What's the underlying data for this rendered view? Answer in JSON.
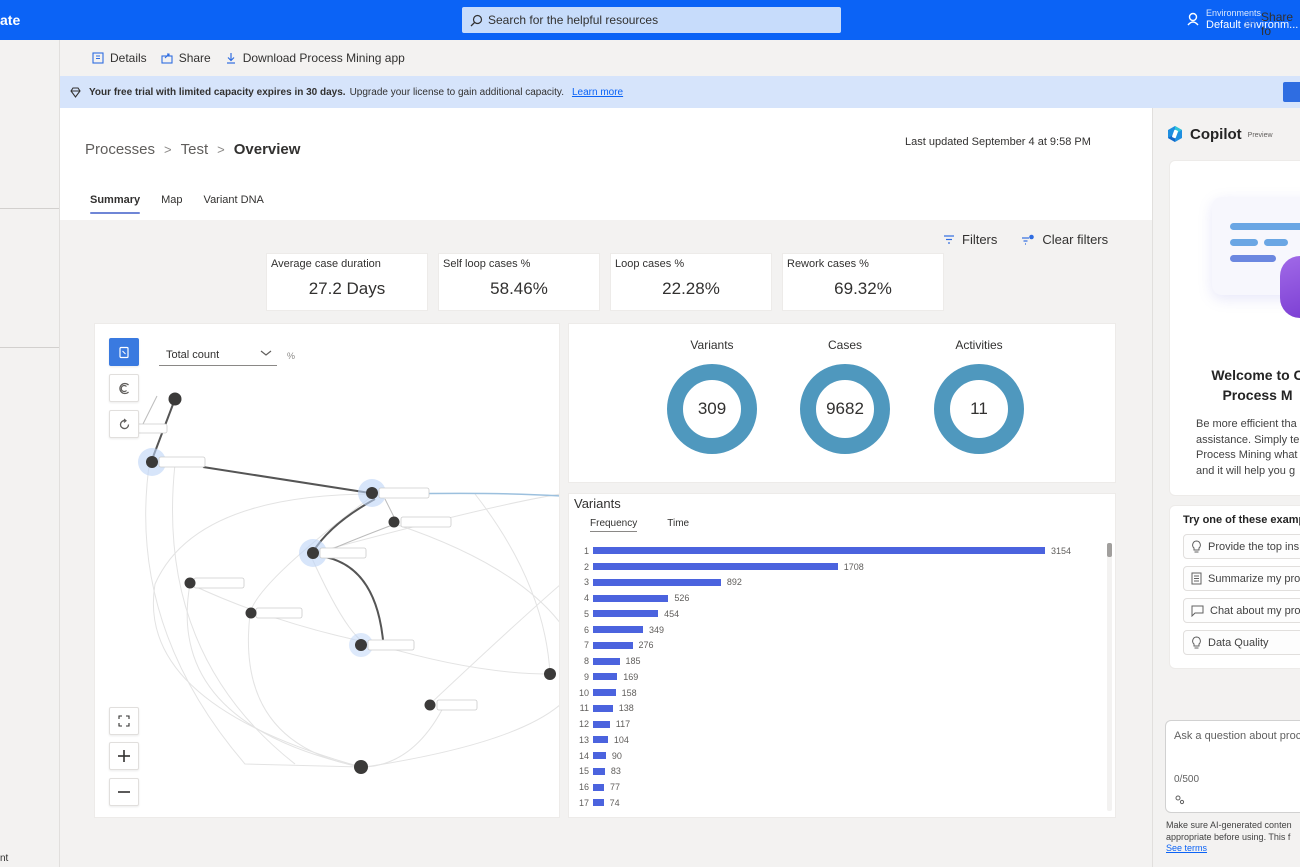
{
  "topbar": {
    "app_title": "ate",
    "search_placeholder": "Search for the helpful resources",
    "environment_label": "Environments",
    "environment_value": "Default environm..."
  },
  "leftnav": {
    "bottom_text": "nt"
  },
  "commandbar": {
    "details": "Details",
    "share": "Share",
    "download": "Download Process Mining app",
    "share_right": "Share fo"
  },
  "banner": {
    "bold": "Your free trial with limited capacity expires in 30 days.",
    "text": "Upgrade your license to gain additional capacity.",
    "link": "Learn more"
  },
  "breadcrumb": {
    "items": [
      "Processes",
      "Test"
    ],
    "current": "Overview",
    "separator": ">"
  },
  "last_updated": "Last updated September 4 at 9:58 PM",
  "tabs": [
    {
      "label": "Summary",
      "active": true
    },
    {
      "label": "Map",
      "active": false
    },
    {
      "label": "Variant DNA",
      "active": false
    }
  ],
  "filters": {
    "filters_label": "Filters",
    "clear_label": "Clear filters"
  },
  "kpis": [
    {
      "label": "Average case duration",
      "value": "27.2 Days"
    },
    {
      "label": "Self loop cases %",
      "value": "58.46%"
    },
    {
      "label": "Loop cases %",
      "value": "22.28%"
    },
    {
      "label": "Rework cases %",
      "value": "69.32%"
    }
  ],
  "process_map": {
    "measure_select": "Total count",
    "percent_toggle": "%"
  },
  "stats": [
    {
      "label": "Variants",
      "value": "309"
    },
    {
      "label": "Cases",
      "value": "9682"
    },
    {
      "label": "Activities",
      "value": "11"
    }
  ],
  "variants": {
    "title": "Variants",
    "tabs": [
      "Frequency",
      "Time"
    ],
    "active_tab": "Frequency",
    "max": 3154,
    "items": [
      {
        "rank": "1",
        "value": 3154
      },
      {
        "rank": "2",
        "value": 1708
      },
      {
        "rank": "3",
        "value": 892
      },
      {
        "rank": "4",
        "value": 526
      },
      {
        "rank": "5",
        "value": 454
      },
      {
        "rank": "6",
        "value": 349
      },
      {
        "rank": "7",
        "value": 276
      },
      {
        "rank": "8",
        "value": 185
      },
      {
        "rank": "9",
        "value": 169
      },
      {
        "rank": "10",
        "value": 158
      },
      {
        "rank": "11",
        "value": 138
      },
      {
        "rank": "12",
        "value": 117
      },
      {
        "rank": "13",
        "value": 104
      },
      {
        "rank": "14",
        "value": 90
      },
      {
        "rank": "15",
        "value": 83
      },
      {
        "rank": "16",
        "value": 77
      },
      {
        "rank": "17",
        "value": 74
      }
    ]
  },
  "copilot": {
    "title": "Copilot",
    "badge": "Preview",
    "welcome_line1": "Welcome to C",
    "welcome_line2": "Process M",
    "description": [
      "Be more efficient tha",
      "assistance. Simply tel",
      "Process Mining what",
      "and it will help you g"
    ],
    "examples_title": "Try one of these examp",
    "examples": [
      {
        "icon": "lightbulb-icon",
        "label": "Provide the top ins"
      },
      {
        "icon": "document-icon",
        "label": "Summarize my pro"
      },
      {
        "icon": "chat-icon",
        "label": "Chat about my pro"
      },
      {
        "icon": "lightbulb-icon",
        "label": "Data Quality"
      }
    ],
    "input_placeholder": "Ask a question about proc",
    "char_counter": "0/500",
    "disclaimer": [
      "Make sure AI-generated conten",
      "appropriate before using. This f"
    ],
    "terms_link": "See terms"
  }
}
